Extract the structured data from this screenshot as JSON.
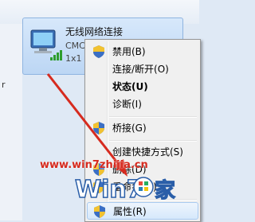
{
  "background": {
    "left_fragment": "r"
  },
  "network": {
    "name": "无线网络连接",
    "status": "CMCC",
    "type": "1x1 11"
  },
  "context_menu": {
    "items": [
      {
        "label": "禁用(B)",
        "shield": true,
        "bold": false
      },
      {
        "label": "连接/断开(O)",
        "shield": false,
        "bold": false
      },
      {
        "label": "状态(U)",
        "shield": false,
        "bold": true
      },
      {
        "label": "诊断(I)",
        "shield": false,
        "bold": false
      },
      {
        "label": "桥接(G)",
        "shield": true,
        "bold": false
      },
      {
        "label": "创建快捷方式(S)",
        "shield": false,
        "bold": false
      },
      {
        "label": "删除(D)",
        "shield": true,
        "bold": false
      },
      {
        "label": "重命名(M)",
        "shield": true,
        "bold": false
      },
      {
        "label": "属性(R)",
        "shield": true,
        "bold": false,
        "highlighted": true
      }
    ]
  },
  "watermark": {
    "url": "www.win7zhijia.cn",
    "logo_text": "Win7家"
  },
  "colors": {
    "accent": "#d62b1f",
    "selection": "#d6e8fb"
  }
}
